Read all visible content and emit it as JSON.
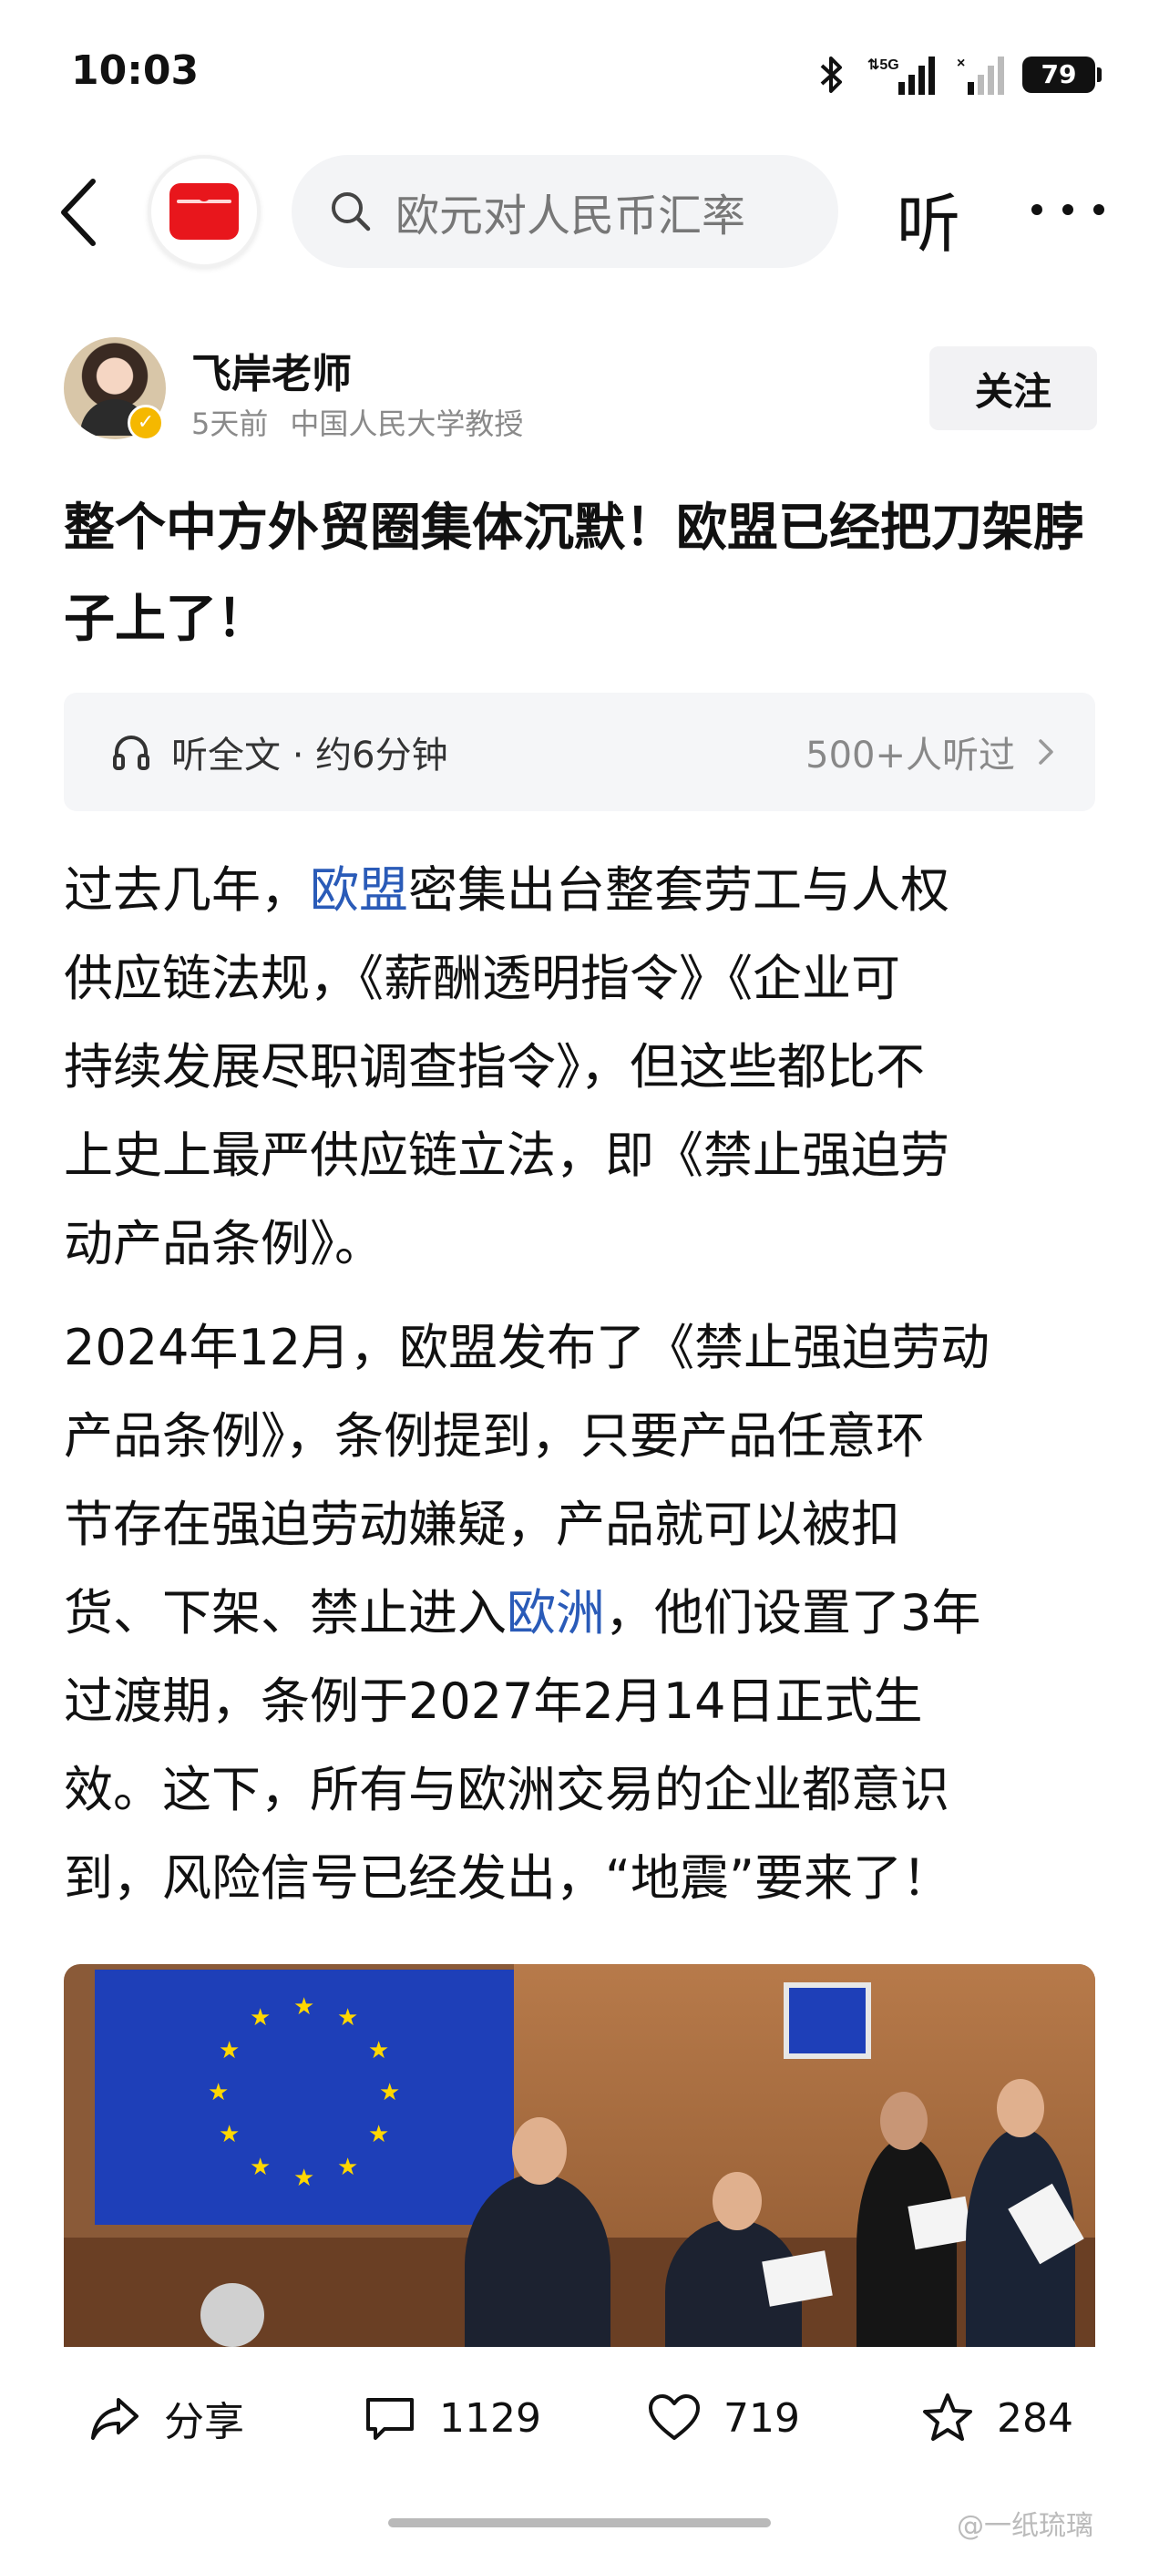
{
  "status_bar": {
    "time": "10:03",
    "signal_label": "5G",
    "battery": "79"
  },
  "nav": {
    "search_text": "欧元对人民币汇率",
    "listen_label": "听"
  },
  "author": {
    "name": "飞岸老师",
    "time": "5天前",
    "title": "中国人民大学教授",
    "follow_label": "关注",
    "verified": true
  },
  "article": {
    "title": "整个中方外贸圈集体沉默！欧盟已经把刀架脖子上了！",
    "listen_bar": {
      "label": "听全文 · 约6分钟",
      "count": "500+人听过"
    },
    "paragraph_1": {
      "l1_a": "过去几年，",
      "l1_link": "欧盟",
      "l1_b": "密集出台整套劳工与人权",
      "l2": "供应链法规，《薪酬透明指令》《企业可",
      "l3": "持续发展尽职调查指令》，但这些都比不",
      "l4": "上史上最严供应链立法，即《禁止强迫劳",
      "l5": "动产品条例》。"
    },
    "paragraph_2": {
      "l1": "2024年12月，欧盟发布了《禁止强迫劳动",
      "l2": "产品条例》，条例提到，只要产品任意环",
      "l3": "节存在强迫劳动嫌疑，产品就可以被扣",
      "l4_a": "货、下架、禁止进入",
      "l4_link": "欧洲",
      "l4_b": "，他们设置了3年",
      "l5": "过渡期，条例于2027年2月14日正式生",
      "l6": "效。这下，所有与欧洲交易的企业都意识",
      "l7": "到，风险信号已经发出，“地震”要来了！"
    }
  },
  "actions": {
    "share_label": "分享",
    "comment_count": "1129",
    "like_count": "719",
    "favorite_count": "284"
  },
  "watermark": "@一纸琉璃",
  "colors": {
    "link": "#2a5bb8",
    "brand_red": "#e8161c",
    "verify_gold": "#f5b800"
  }
}
